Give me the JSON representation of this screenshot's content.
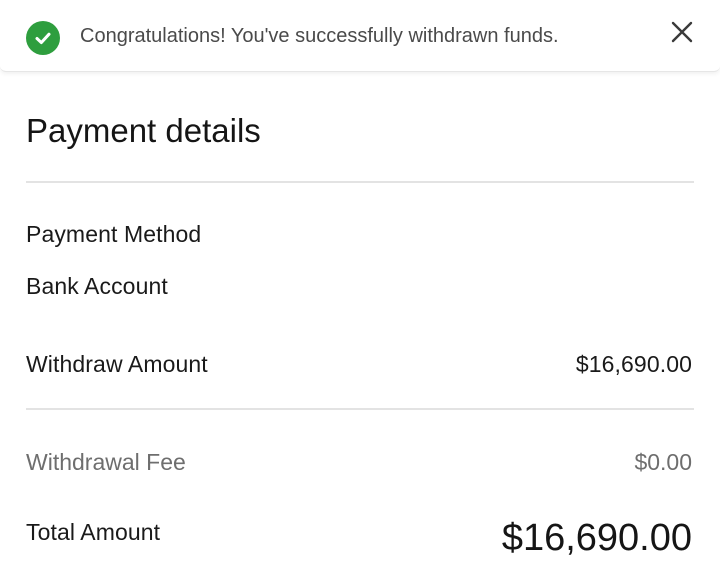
{
  "toast": {
    "message": "Congratulations! You've successfully withdrawn funds.",
    "icon": "check-circle-icon",
    "close_icon": "close-icon",
    "accent_color": "#2e9e3e"
  },
  "payment_details": {
    "title": "Payment details",
    "payment_method_label": "Payment Method",
    "payment_method_value": "Bank Account",
    "withdraw_amount_label": "Withdraw Amount",
    "withdraw_amount_value": "$16,690.00",
    "withdrawal_fee_label": "Withdrawal Fee",
    "withdrawal_fee_value": "$0.00",
    "total_amount_label": "Total Amount",
    "total_amount_value": "$16,690.00"
  }
}
